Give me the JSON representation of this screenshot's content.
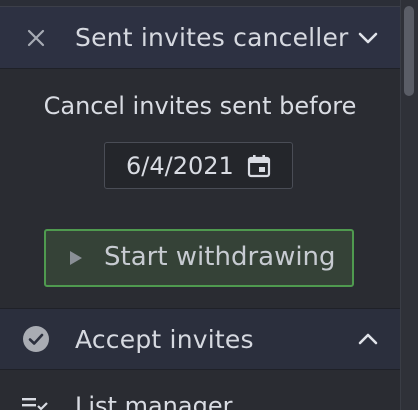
{
  "sections": {
    "canceller": {
      "title": "Sent invites canceller",
      "close_icon": "close-icon",
      "chevron_icon": "chevron-down-icon"
    },
    "canceller_body": {
      "caption": "Cancel invites sent before",
      "date_value": "6/4/2021",
      "calendar_icon": "calendar-icon",
      "start_button": "Start withdrawing",
      "play_icon": "play-icon"
    },
    "accept": {
      "title": "Accept invites",
      "check_icon": "check-circle-icon",
      "chevron_icon": "chevron-up-icon"
    },
    "list_manager": {
      "label": "List manager",
      "icon": "playlist-check-icon"
    }
  },
  "colors": {
    "header_bg": "#2d3142",
    "panel_bg": "#2a2c32",
    "accent_green": "#4f9a4f",
    "button_bg": "#354237",
    "text": "#d9dce3"
  }
}
